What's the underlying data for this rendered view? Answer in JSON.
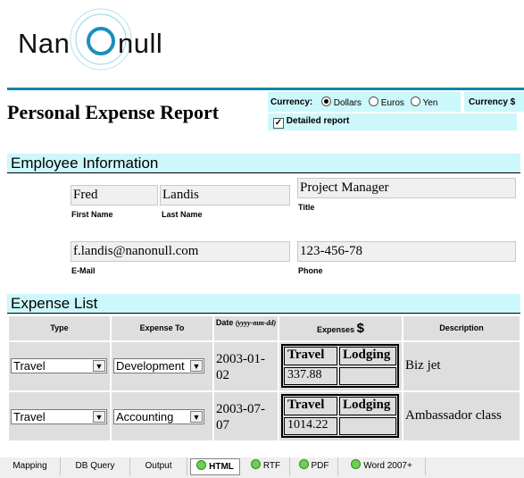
{
  "logo": {
    "text_left": "Nan",
    "text_right": "null"
  },
  "report": {
    "title": "Personal Expense Report"
  },
  "currency": {
    "label": "Currency:",
    "options": [
      "Dollars",
      "Euros",
      "Yen"
    ],
    "selected": "Dollars",
    "right_label": "Currency $",
    "detailed_label": "Detailed report",
    "detailed_checked": true
  },
  "employee": {
    "section_title": "Employee Information",
    "first_name": "Fred",
    "first_name_label": "First Name",
    "last_name": "Landis",
    "last_name_label": "Last Name",
    "title": "Project Manager",
    "title_label": "Title",
    "email": "f.landis@nanonull.com",
    "email_label": "E-Mail",
    "phone": "123-456-78",
    "phone_label": "Phone"
  },
  "expenses": {
    "section_title": "Expense List",
    "headers": {
      "type": "Type",
      "expense_to": "Expense To",
      "date": "Date",
      "date_format": "(yyyy-mm-dd)",
      "expenses": "Expenses",
      "currency_symbol": "$",
      "description": "Description"
    },
    "sub_headers": {
      "travel": "Travel",
      "lodging": "Lodging"
    },
    "rows": [
      {
        "type": "Travel",
        "expense_to": "Development",
        "date_line1": "2003-01-",
        "date_line2": "02",
        "travel": "337.88",
        "lodging": "",
        "description": "Biz jet"
      },
      {
        "type": "Travel",
        "expense_to": "Accounting",
        "date_line1": "2003-07-",
        "date_line2": "07",
        "travel": "1014.22",
        "lodging": "",
        "description": "Ambassador class"
      }
    ]
  },
  "tabs": [
    {
      "label": "Mapping",
      "icon": ""
    },
    {
      "label": "DB Query",
      "icon": ""
    },
    {
      "label": "Output",
      "icon": ""
    },
    {
      "label": "HTML",
      "icon": "green-circle-icon",
      "active": true
    },
    {
      "label": "RTF",
      "icon": "green-circle-icon"
    },
    {
      "label": "PDF",
      "icon": "green-circle-icon"
    },
    {
      "label": "Word 2007+",
      "icon": "green-circle-icon"
    }
  ],
  "colors": {
    "accent_line": "#0b87a8",
    "section_bg": "#ccf7fb",
    "field_bg": "#f0f0f0",
    "cell_bg": "#dedede"
  }
}
